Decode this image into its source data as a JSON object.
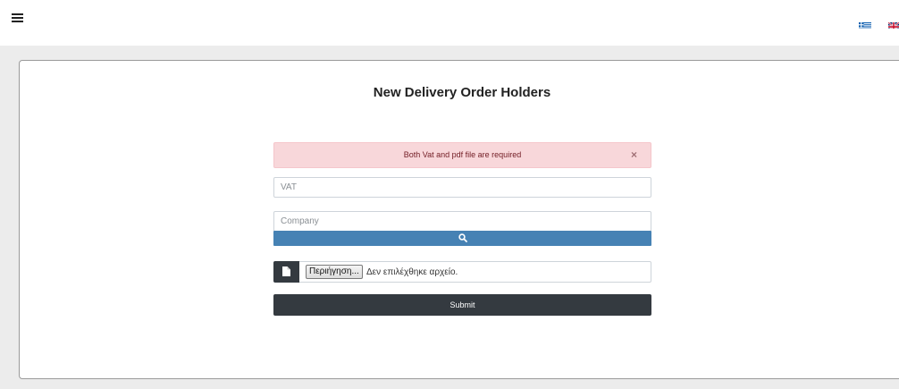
{
  "header": {
    "menu_icon": "hamburger-icon",
    "flags": [
      "greek-flag-icon",
      "uk-flag-icon"
    ]
  },
  "form": {
    "title": "New Delivery Order Holders",
    "alert": {
      "message": "Both Vat and pdf file are required",
      "close_symbol": "×"
    },
    "vat_placeholder": "VAT",
    "company_placeholder": "Company",
    "search_icon": "search-icon",
    "file": {
      "icon": "file-icon",
      "browse_label": "Περιήγηση...",
      "status": "Δεν επιλέχθηκε αρχείο."
    },
    "submit_label": "Submit"
  },
  "colors": {
    "alert_bg": "#f8d7da",
    "alert_text": "#721c24",
    "search_button": "#4682b4",
    "dark_button": "#343a40"
  }
}
